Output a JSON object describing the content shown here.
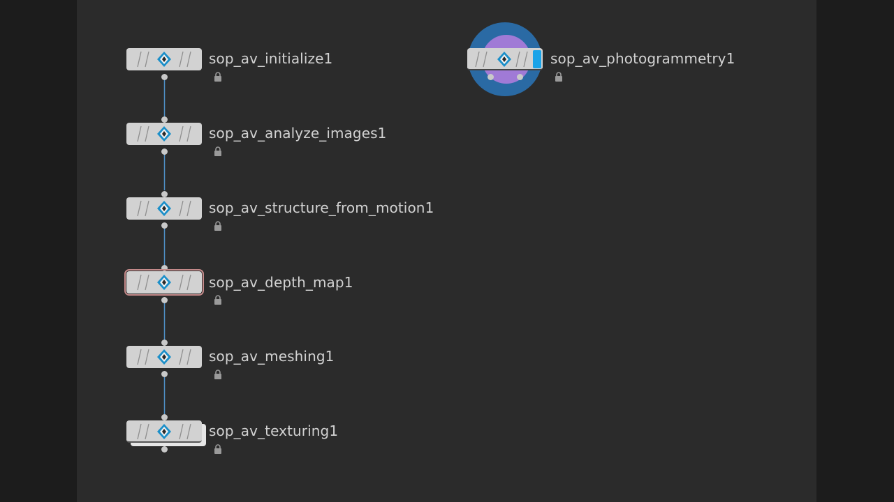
{
  "network": {
    "nodes": [
      {
        "id": "init",
        "label": "sop_av_initialize1"
      },
      {
        "id": "analyze",
        "label": "sop_av_analyze_images1"
      },
      {
        "id": "sfm",
        "label": "sop_av_structure_from_motion1"
      },
      {
        "id": "depth",
        "label": "sop_av_depth_map1",
        "selected": true
      },
      {
        "id": "mesh",
        "label": "sop_av_meshing1"
      },
      {
        "id": "tex",
        "label": "sop_av_texturing1"
      },
      {
        "id": "photo",
        "label": "sop_av_photogrammetry1",
        "subnet": true
      }
    ]
  },
  "colors": {
    "wire": "#4f8fc5",
    "node": "#d2d2d2",
    "selection": "#c48a8a",
    "ring_outer": "#2a6aa4",
    "ring_inner": "#a07ad6",
    "flag": "#1aa3e8"
  },
  "icons": [
    "houdini-sop-icon",
    "lock-icon"
  ]
}
